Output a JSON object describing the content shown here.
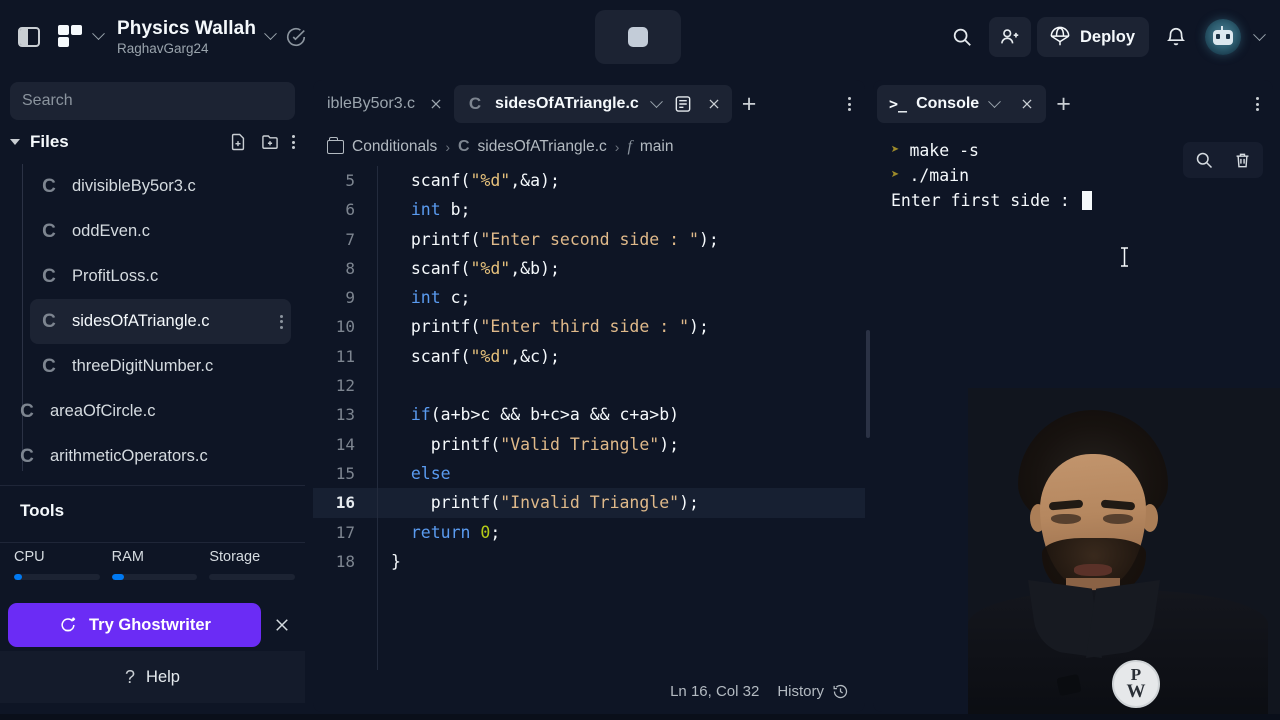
{
  "header": {
    "panel_toggle_icon": "sidebar-toggle-icon",
    "workspace_logo_icon": "replit-logo-icon",
    "project_title": "Physics Wallah",
    "project_owner": "RaghavGarg24",
    "status_icon": "check-circle-icon",
    "run_stop_icon": "stop-square-icon",
    "search_icon": "search-icon",
    "invite_icon": "invite-user-icon",
    "deploy_icon": "parachute-icon",
    "deploy_label": "Deploy",
    "notifications_icon": "bell-icon",
    "avatar_icon": "robot-avatar-icon",
    "avatar_chevron_icon": "chevron-down-icon"
  },
  "sidebar": {
    "search": {
      "placeholder": "Search",
      "value": ""
    },
    "files_section": {
      "label": "Files",
      "expanded": true,
      "new_file_icon": "new-file-icon",
      "new_folder_icon": "new-folder-icon",
      "more_icon": "kebab-menu-icon"
    },
    "files": [
      {
        "name": "divisibleBy5or3.c",
        "icon": "c-file-icon",
        "nested": true,
        "active": false
      },
      {
        "name": "oddEven.c",
        "icon": "c-file-icon",
        "nested": true,
        "active": false
      },
      {
        "name": "ProfitLoss.c",
        "icon": "c-file-icon",
        "nested": true,
        "active": false
      },
      {
        "name": "sidesOfATriangle.c",
        "icon": "c-file-icon",
        "nested": true,
        "active": true
      },
      {
        "name": "threeDigitNumber.c",
        "icon": "c-file-icon",
        "nested": true,
        "active": false
      },
      {
        "name": "areaOfCircle.c",
        "icon": "c-file-icon",
        "nested": false,
        "active": false
      },
      {
        "name": "arithmeticOperators.c",
        "icon": "c-file-icon",
        "nested": false,
        "active": false
      }
    ],
    "tools_section": {
      "label": "Tools",
      "expanded": false
    },
    "resources": [
      {
        "label": "CPU",
        "percent": 6
      },
      {
        "label": "RAM",
        "percent": 12
      },
      {
        "label": "Storage",
        "percent": 0
      }
    ],
    "ghostwriter": {
      "label": "Try Ghostwriter",
      "icon": "ghostwriter-sparkle-icon",
      "close_icon": "close-icon",
      "color": "#6b2cf5"
    },
    "help": {
      "label": "Help",
      "icon": "question-mark-icon"
    }
  },
  "editor": {
    "tabs": [
      {
        "label": "ibleBy5or3.c",
        "icon": "",
        "active": false,
        "close_icon": "close-icon"
      },
      {
        "label": "sidesOfATriangle.c",
        "icon": "c-file-icon",
        "active": true,
        "chevron_icon": "chevron-down-icon",
        "doc_icon": "document-preview-icon",
        "close_icon": "close-icon"
      }
    ],
    "new_tab_icon": "plus-icon",
    "more_icon": "kebab-menu-icon",
    "breadcrumb": {
      "folder_icon": "folder-icon",
      "folder": "Conditionals",
      "file_icon": "c-file-icon",
      "file": "sidesOfATriangle.c",
      "symbol_icon": "function-icon",
      "symbol": "main",
      "separator": "›"
    },
    "first_visible_line": 5,
    "highlighted_line": 16,
    "lines": [
      {
        "n": 5,
        "tokens": [
          {
            "t": "  ",
            "c": "pun"
          },
          {
            "t": "scanf",
            "c": "fn"
          },
          {
            "t": "(",
            "c": "pun"
          },
          {
            "t": "\"%d\"",
            "c": "str"
          },
          {
            "t": ",&a);",
            "c": "pun"
          }
        ]
      },
      {
        "n": 6,
        "tokens": [
          {
            "t": "  ",
            "c": "pun"
          },
          {
            "t": "int",
            "c": "kw"
          },
          {
            "t": " b;",
            "c": "pun"
          }
        ]
      },
      {
        "n": 7,
        "tokens": [
          {
            "t": "  ",
            "c": "pun"
          },
          {
            "t": "printf",
            "c": "fn"
          },
          {
            "t": "(",
            "c": "pun"
          },
          {
            "t": "\"Enter second side : \"",
            "c": "strtxt"
          },
          {
            "t": ");",
            "c": "pun"
          }
        ]
      },
      {
        "n": 8,
        "tokens": [
          {
            "t": "  ",
            "c": "pun"
          },
          {
            "t": "scanf",
            "c": "fn"
          },
          {
            "t": "(",
            "c": "pun"
          },
          {
            "t": "\"%d\"",
            "c": "str"
          },
          {
            "t": ",&b);",
            "c": "pun"
          }
        ]
      },
      {
        "n": 9,
        "tokens": [
          {
            "t": "  ",
            "c": "pun"
          },
          {
            "t": "int",
            "c": "kw"
          },
          {
            "t": " c;",
            "c": "pun"
          }
        ]
      },
      {
        "n": 10,
        "tokens": [
          {
            "t": "  ",
            "c": "pun"
          },
          {
            "t": "printf",
            "c": "fn"
          },
          {
            "t": "(",
            "c": "pun"
          },
          {
            "t": "\"Enter third side : \"",
            "c": "strtxt"
          },
          {
            "t": ");",
            "c": "pun"
          }
        ]
      },
      {
        "n": 11,
        "tokens": [
          {
            "t": "  ",
            "c": "pun"
          },
          {
            "t": "scanf",
            "c": "fn"
          },
          {
            "t": "(",
            "c": "pun"
          },
          {
            "t": "\"%d\"",
            "c": "str"
          },
          {
            "t": ",&c);",
            "c": "pun"
          }
        ]
      },
      {
        "n": 12,
        "tokens": [
          {
            "t": "",
            "c": "pun"
          }
        ]
      },
      {
        "n": 13,
        "tokens": [
          {
            "t": "  ",
            "c": "pun"
          },
          {
            "t": "if",
            "c": "kwc"
          },
          {
            "t": "(a+b>c && b+c>a && c+a>b)",
            "c": "pun"
          }
        ]
      },
      {
        "n": 14,
        "tokens": [
          {
            "t": "    ",
            "c": "pun"
          },
          {
            "t": "printf",
            "c": "fn"
          },
          {
            "t": "(",
            "c": "pun"
          },
          {
            "t": "\"Valid Triangle\"",
            "c": "strtxt"
          },
          {
            "t": ");",
            "c": "pun"
          }
        ]
      },
      {
        "n": 15,
        "tokens": [
          {
            "t": "  ",
            "c": "pun"
          },
          {
            "t": "else",
            "c": "kwc"
          }
        ]
      },
      {
        "n": 16,
        "tokens": [
          {
            "t": "    ",
            "c": "pun"
          },
          {
            "t": "printf",
            "c": "fn"
          },
          {
            "t": "(",
            "c": "pun"
          },
          {
            "t": "\"Invalid Triangle\"",
            "c": "strtxt"
          },
          {
            "t": ");",
            "c": "pun"
          }
        ]
      },
      {
        "n": 17,
        "tokens": [
          {
            "t": "  ",
            "c": "pun"
          },
          {
            "t": "return",
            "c": "kw"
          },
          {
            "t": " ",
            "c": "pun"
          },
          {
            "t": "0",
            "c": "num"
          },
          {
            "t": ";",
            "c": "pun"
          }
        ]
      },
      {
        "n": 18,
        "tokens": [
          {
            "t": "}",
            "c": "pun"
          }
        ]
      }
    ],
    "status": {
      "cursor": "Ln 16, Col 32",
      "history_label": "History",
      "history_icon": "history-clock-icon"
    }
  },
  "console": {
    "tab": {
      "label": "Console",
      "prompt_icon": "terminal-prompt-icon",
      "chevron_icon": "chevron-down-icon",
      "close_icon": "close-icon"
    },
    "new_tab_icon": "plus-icon",
    "more_icon": "kebab-menu-icon",
    "search_icon": "search-icon",
    "clear_icon": "trash-icon",
    "lines": [
      {
        "prompt": true,
        "text": "make -s"
      },
      {
        "prompt": true,
        "text": "./main"
      },
      {
        "prompt": false,
        "text": "Enter first side : "
      }
    ],
    "cursor_visible": true,
    "mouse_cursor_icon": "text-ibeam-cursor"
  },
  "webcam": {
    "logo_top": "P",
    "logo_bottom": "W",
    "overlay_name": "instructor-webcam-overlay"
  }
}
